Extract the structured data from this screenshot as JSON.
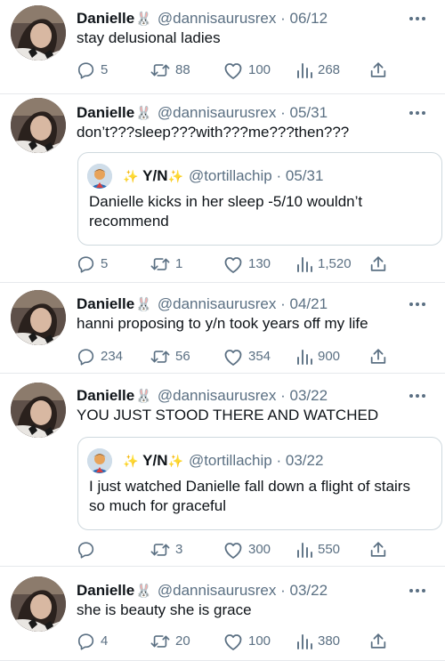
{
  "colors": {
    "text": "#0f1419",
    "secondary": "#5b7083",
    "divider": "#e6e9ec",
    "quote_border": "#cfd9de"
  },
  "icons": [
    "reply-icon",
    "retweet-icon",
    "like-icon",
    "views-icon",
    "share-icon",
    "more-icon",
    "bunny-icon",
    "sparkle-icon"
  ],
  "tweets": [
    {
      "name": "Danielle",
      "handle": "@dannisaurusrex",
      "date": "06/12",
      "text": "stay delusional ladies",
      "replies": "5",
      "retweets": "88",
      "likes": "100",
      "views": "268"
    },
    {
      "name": "Danielle",
      "handle": "@dannisaurusrex",
      "date": "05/31",
      "text": "don’t???sleep???with???me???then???",
      "quote": {
        "name": "Y/N",
        "handle": "@tortillachip",
        "date": "05/31",
        "text": "Danielle kicks in her sleep -5/10 wouldn’t recommend"
      },
      "replies": "5",
      "retweets": "1",
      "likes": "130",
      "views": "1,520"
    },
    {
      "name": "Danielle",
      "handle": "@dannisaurusrex",
      "date": "04/21",
      "text": "hanni proposing to y/n took years off my life",
      "replies": "234",
      "retweets": "56",
      "likes": "354",
      "views": "900"
    },
    {
      "name": "Danielle",
      "handle": "@dannisaurusrex",
      "date": "03/22",
      "text": "YOU JUST STOOD THERE AND WATCHED",
      "quote": {
        "name": "Y/N",
        "handle": "@tortillachip",
        "date": "03/22",
        "text": "I just watched Danielle fall down a flight of stairs so much for graceful"
      },
      "replies": "",
      "retweets": "3",
      "likes": "300",
      "views": "550"
    },
    {
      "name": "Danielle",
      "handle": "@dannisaurusrex",
      "date": "03/22",
      "text": "she is beauty she is grace",
      "replies": "4",
      "retweets": "20",
      "likes": "100",
      "views": "380"
    }
  ]
}
